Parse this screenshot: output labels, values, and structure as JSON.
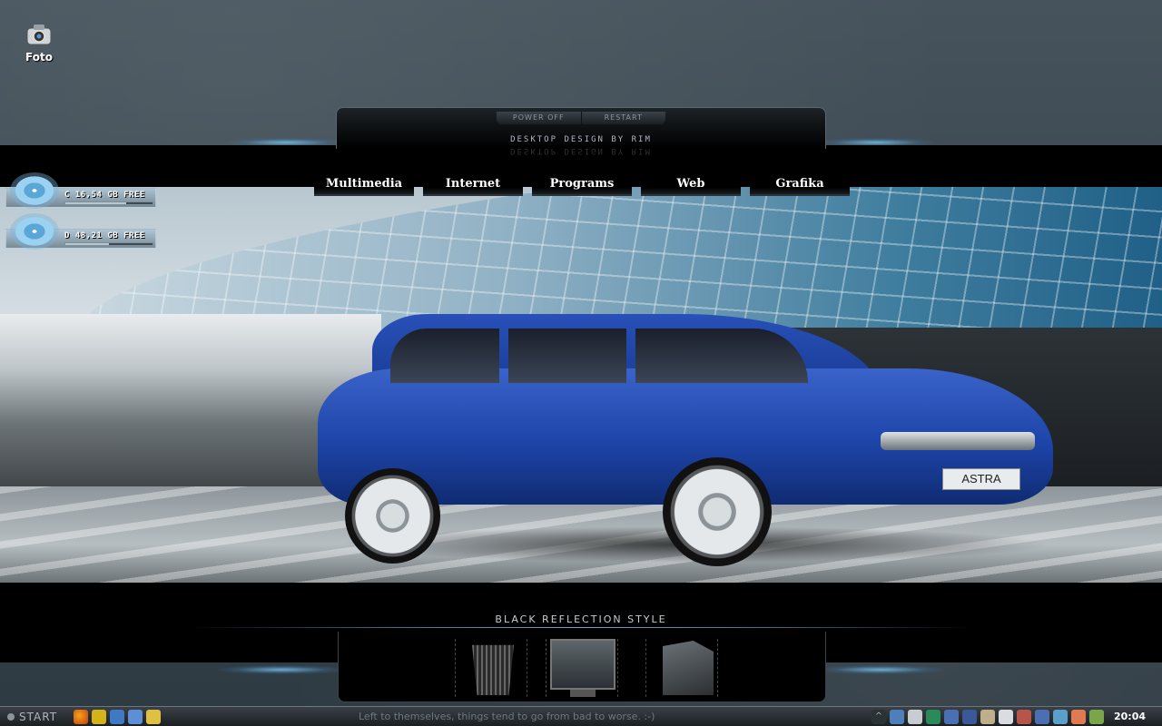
{
  "desktop": {
    "icon_label": "Foto"
  },
  "power_panel": {
    "power_off": "POWER OFF",
    "restart": "RESTART",
    "credit": "DESKTOP DESIGN BY RIM"
  },
  "menu": {
    "items": [
      "Multimedia",
      "Internet",
      "Programs",
      "Web",
      "Grafika"
    ]
  },
  "drives": [
    {
      "text": "C 16,54 GB FREE",
      "fill": 0.7
    },
    {
      "text": "D 48,21 GB FREE",
      "fill": 0.5
    }
  ],
  "wallpaper": {
    "plate_text": "ASTRA"
  },
  "dock": {
    "title": "BLACK REFLECTION STYLE",
    "items": [
      "recycle-bin",
      "my-computer",
      "documents"
    ]
  },
  "taskbar": {
    "start_label": "START",
    "marquee": "Left to themselves, things tend to go from bad to worse. :-)",
    "clock": "20:04"
  },
  "colors": {
    "accent_glow": "#6fa6c8",
    "car_blue": "#1d44a8"
  }
}
